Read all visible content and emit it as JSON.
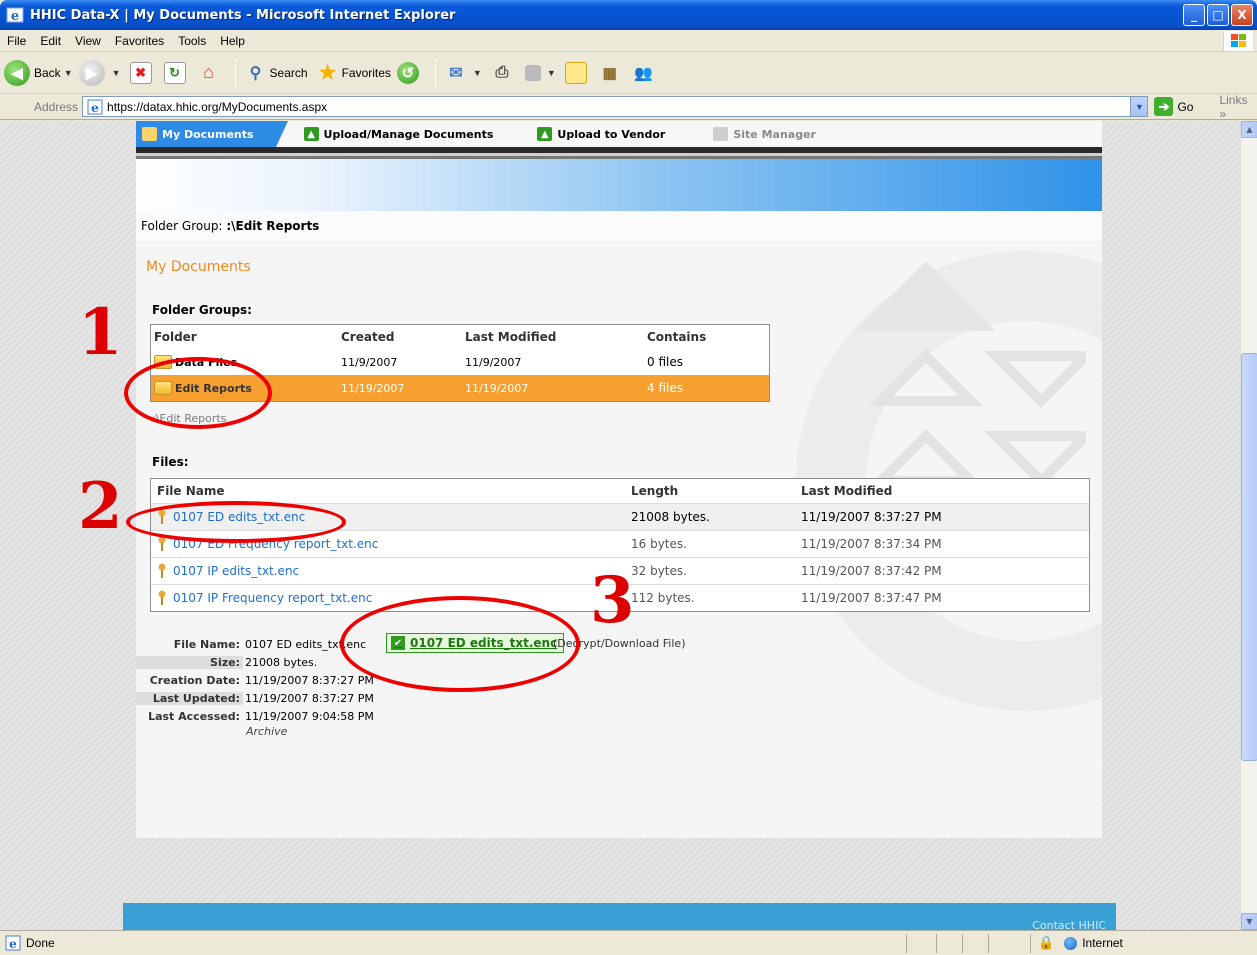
{
  "window": {
    "title": "HHIC Data-X | My Documents - Microsoft Internet Explorer",
    "min_label": "_",
    "max_label": "□",
    "close_label": "X"
  },
  "menu": [
    "File",
    "Edit",
    "View",
    "Favorites",
    "Tools",
    "Help"
  ],
  "toolbar": {
    "back": "Back",
    "search": "Search",
    "favorites": "Favorites"
  },
  "address": {
    "label": "Address",
    "url": "https://datax.hhic.org/MyDocuments.aspx",
    "go": "Go",
    "links": "Links"
  },
  "nav_tabs": [
    {
      "label": "My Documents",
      "active": true
    },
    {
      "label": "Upload/Manage Documents",
      "active": false
    },
    {
      "label": "Upload to Vendor",
      "active": false
    },
    {
      "label": "Site Manager",
      "active": false
    }
  ],
  "folder_group_line": {
    "label": "Folder Group:",
    "value": ":\\Edit Reports"
  },
  "page_heading": "My Documents",
  "folder_groups": {
    "heading": "Folder Groups:",
    "columns": [
      "Folder",
      "Created",
      "Last Modified",
      "Contains"
    ],
    "rows": [
      {
        "folder": "Data Files",
        "created": "11/9/2007",
        "modified": "11/9/2007",
        "contains": "0 files",
        "selected": false
      },
      {
        "folder": "Edit Reports",
        "created": "11/19/2007",
        "modified": "11/19/2007",
        "contains": "4 files",
        "selected": true
      }
    ],
    "breadcrumb": ":\\Edit Reports"
  },
  "files": {
    "heading": "Files:",
    "columns": [
      "File Name",
      "Length",
      "Last Modified"
    ],
    "rows": [
      {
        "name": "0107 ED edits_txt.enc",
        "length": "21008 bytes.",
        "modified": "11/19/2007 8:37:27 PM"
      },
      {
        "name": "0107 ED Frequency report_txt.enc",
        "length": "16 bytes.",
        "modified": "11/19/2007 8:37:34 PM"
      },
      {
        "name": "0107 IP edits_txt.enc",
        "length": "32 bytes.",
        "modified": "11/19/2007 8:37:42 PM"
      },
      {
        "name": "0107 IP Frequency report_txt.enc",
        "length": "112 bytes.",
        "modified": "11/19/2007 8:37:47 PM"
      }
    ]
  },
  "details": {
    "file_name_label": "File Name:",
    "file_name": "0107 ED edits_txt.enc",
    "size_label": "Size:",
    "size": "21008 bytes.",
    "created_label": "Creation Date:",
    "created": "11/19/2007 8:37:27 PM",
    "updated_label": "Last Updated:",
    "updated": "11/19/2007 8:37:27 PM",
    "accessed_label": "Last Accessed:",
    "accessed": "11/19/2007 9:04:58 PM",
    "archive": "Archive",
    "download_link": "0107 ED edits_txt.enc",
    "download_note": "(Decrypt/Download File)"
  },
  "footer": {
    "contact": "Contact HHIC"
  },
  "annotations": [
    "1",
    "2",
    "3"
  ],
  "status": {
    "text": "Done",
    "zone": "Internet"
  },
  "colors": {
    "accent_orange": "#f7a02f",
    "link_blue": "#1f6fcf",
    "annotation_red": "#e00000"
  }
}
